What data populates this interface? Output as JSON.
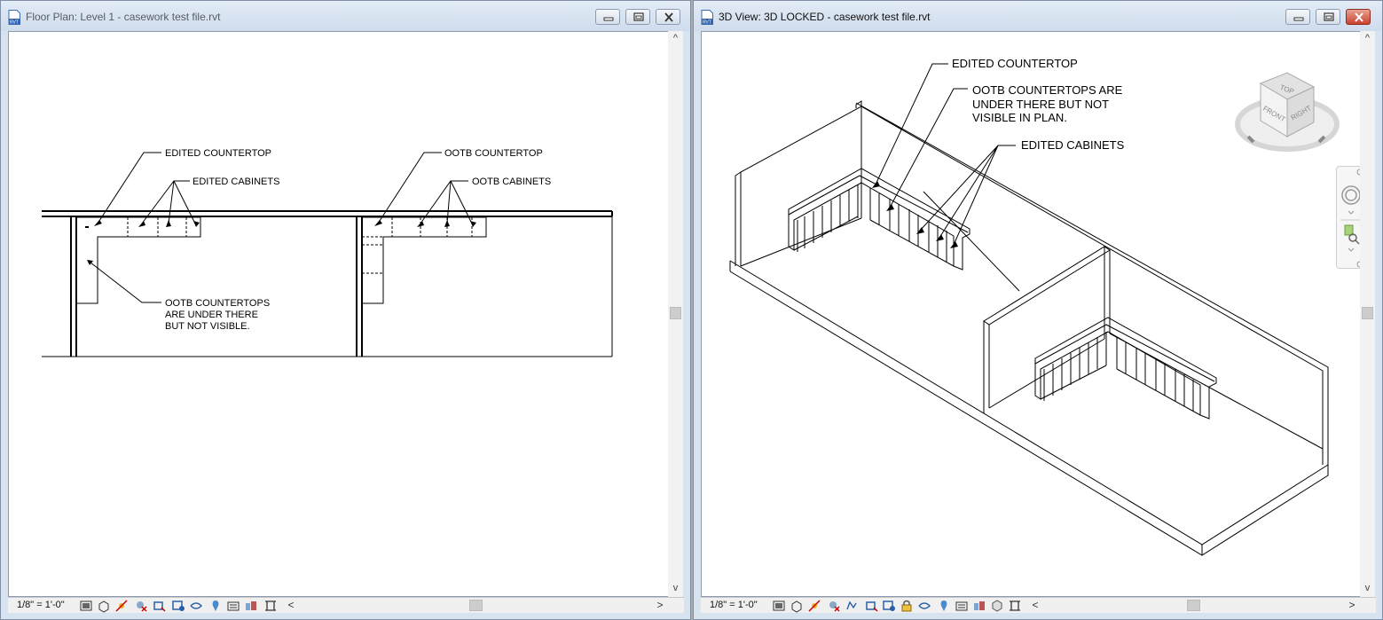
{
  "left_window": {
    "title": "Floor Plan: Level 1 - casework test file.rvt",
    "scale": "1/8\" = 1'-0\"",
    "annotations": {
      "edited_countertop": "EDITED COUNTERTOP",
      "edited_cabinets": "EDITED CABINETS",
      "ootb_countertop": "OOTB COUNTERTOP",
      "ootb_cabinets": "OOTB CABINETS",
      "ootb_note_line1": "OOTB COUNTERTOPS",
      "ootb_note_line2": "ARE UNDER THERE",
      "ootb_note_line3": "BUT NOT VISIBLE."
    }
  },
  "right_window": {
    "title": "3D View: 3D LOCKED - casework test file.rvt",
    "scale": "1/8\" = 1'-0\"",
    "annotations": {
      "edited_countertop": "EDITED COUNTERTOP",
      "ootb_note_line1": "OOTB COUNTERTOPS ARE",
      "ootb_note_line2": "UNDER THERE BUT NOT",
      "ootb_note_line3": "VISIBLE IN PLAN.",
      "edited_cabinets": "EDITED CABINETS"
    },
    "viewcube": {
      "top": "TOP",
      "front": "FRONT",
      "right": "RIGHT"
    }
  },
  "icons": {
    "minimize": "minimize-icon",
    "restore": "restore-icon",
    "close": "close-icon"
  },
  "colors": {
    "titlebar": "#d8e3f0",
    "close_active": "#c9432d",
    "canvas": "#ffffff"
  }
}
